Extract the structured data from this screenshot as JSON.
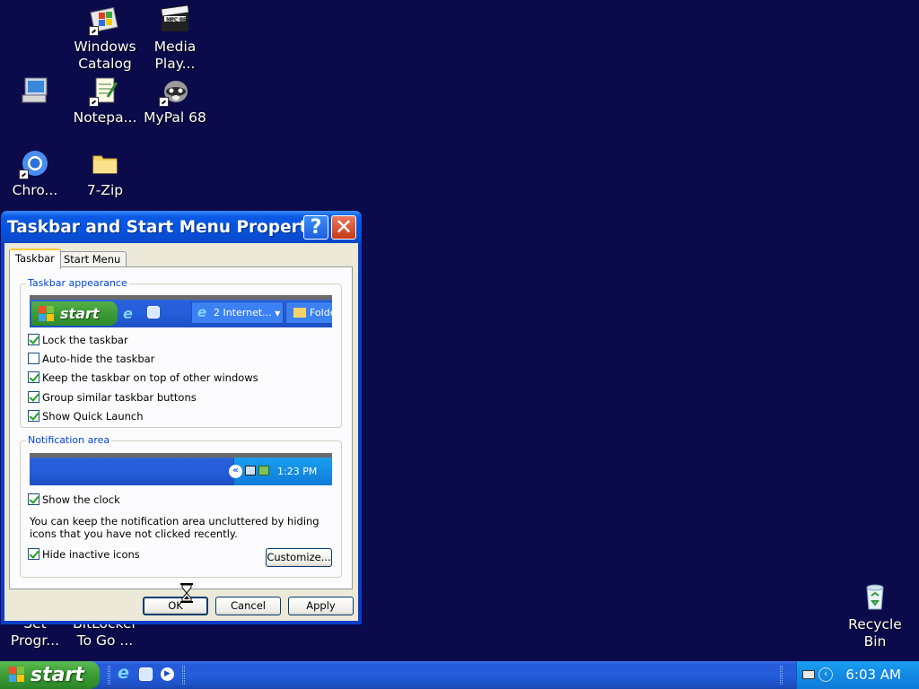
{
  "desktop": {
    "icons": [
      {
        "label": "Windows\nCatalog"
      },
      {
        "label": "Media\nPlay..."
      },
      {
        "label": ""
      },
      {
        "label": "Notepa..."
      },
      {
        "label": "MyPal 68"
      },
      {
        "label": "Chro..."
      },
      {
        "label": "7-Zip"
      },
      {
        "label": "Set\nProgr..."
      },
      {
        "label": "BitLocker\nTo Go ..."
      },
      {
        "label": "Recycle\nBin"
      }
    ]
  },
  "dialog": {
    "title": "Taskbar and Start Menu Propert...",
    "help_label": "?",
    "close_label": "✕",
    "tabs": [
      {
        "label": "Taskbar"
      },
      {
        "label": "Start Menu"
      }
    ],
    "appearance": {
      "legend": "Taskbar appearance",
      "preview_start": "start",
      "preview_group": "2 Internet...",
      "preview_folder": "Folde",
      "options": [
        {
          "label": "Lock the taskbar",
          "checked": true
        },
        {
          "label": "Auto-hide the taskbar",
          "checked": false
        },
        {
          "label": "Keep the taskbar on top of other windows",
          "checked": true
        },
        {
          "label": "Group similar taskbar buttons",
          "checked": true
        },
        {
          "label": "Show Quick Launch",
          "checked": true
        }
      ]
    },
    "notification": {
      "legend": "Notification area",
      "preview_time": "1:23 PM",
      "show_clock": {
        "label": "Show the clock",
        "checked": true
      },
      "description": "You can keep the notification area uncluttered by hiding icons that you have not clicked recently.",
      "hide_inactive": {
        "label": "Hide inactive icons",
        "checked": true
      },
      "customize_label": "Customize..."
    },
    "buttons": {
      "ok": "OK",
      "cancel": "Cancel",
      "apply": "Apply"
    }
  },
  "taskbar": {
    "start_label": "start",
    "clock": "6:03 AM"
  },
  "colors": {
    "desktop": "#0b0a4a",
    "titlebar": "#0653dd",
    "start_green": "#3e9e37",
    "taskbar_blue": "#245ddb",
    "tray_blue": "#1389e3",
    "dialog_face": "#ece9d8",
    "legend_blue": "#0046d5"
  },
  "icon_names": [
    "windows-catalog-icon",
    "media-player-icon",
    "my-computer-icon",
    "notepad-icon",
    "mypal-icon",
    "chrome-icon",
    "folder-icon",
    "recycle-bin-icon",
    "hourglass-cursor-icon"
  ]
}
